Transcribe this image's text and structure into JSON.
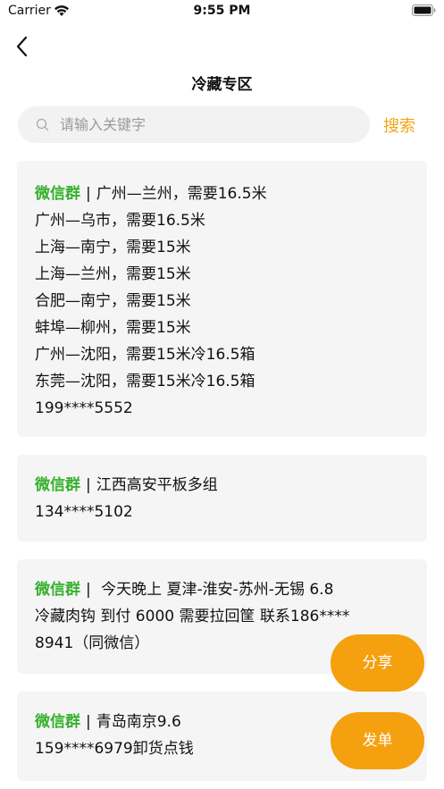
{
  "status_bar": {
    "carrier": "Carrier",
    "time": "9:55 PM"
  },
  "header": {
    "title": "冷藏专区",
    "back_icon": "chevron-left-icon"
  },
  "search": {
    "placeholder": "请输入关键字",
    "button_label": "搜索",
    "accent_color": "#f2a314"
  },
  "cards": [
    {
      "source": "微信群",
      "separator": "|",
      "first_line": "广州—兰州，需要16.5米",
      "lines": [
        "广州—乌市，需要16.5米",
        "上海—南宁，需要15米",
        "上海—兰州，需要15米",
        "合肥—南宁，需要15米",
        "蚌埠—柳州，需要15米",
        "广州—沈阳，需要15米冷16.5箱",
        "东莞—沈阳，需要15米冷16.5箱",
        "199****5552"
      ]
    },
    {
      "source": "微信群",
      "separator": "|",
      "first_line": "江西高安平板多组",
      "lines": [
        "134****5102"
      ]
    },
    {
      "source": "微信群",
      "separator": "|",
      "first_line": " 今天晚上 夏津-淮安-苏州-无锡 6.8",
      "lines": [
        "冷藏肉钩 到付 6000 需要拉回筐 联系186****",
        "8941（同微信）"
      ]
    },
    {
      "source": "微信群",
      "separator": "|",
      "first_line": "青岛南京9.6",
      "lines": [
        "159****6979卸货点钱"
      ]
    }
  ],
  "actions": {
    "share_label": "分享",
    "order_label": "发单",
    "button_color": "#f5a00f"
  },
  "colors": {
    "source_green": "#36b02d",
    "card_bg": "#f5f5f5"
  }
}
